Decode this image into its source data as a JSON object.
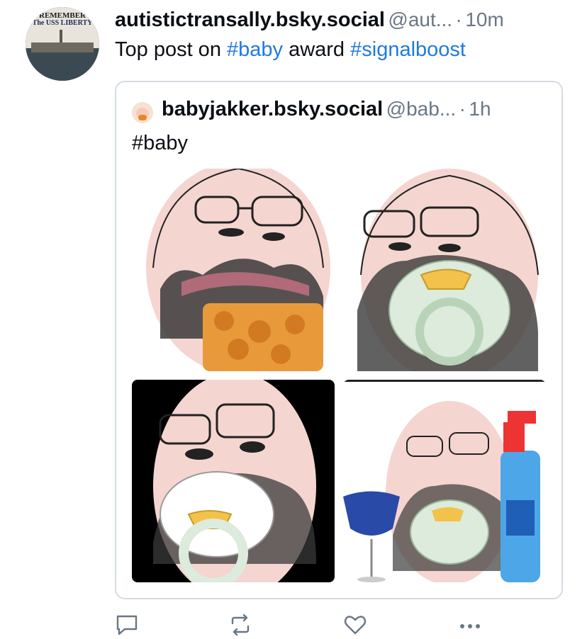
{
  "post": {
    "display_name": "autistictransally.bsky.social",
    "handle": "@aut...",
    "separator": "·",
    "time": "10m",
    "text_plain_1": "Top post on ",
    "tag_1": "#baby",
    "text_plain_2": " award ",
    "tag_2": "#signalboost",
    "avatar_text_line1": "REMEMBER",
    "avatar_text_line2": "The USS LIBERTY"
  },
  "quote": {
    "display_name": "babyjakker.bsky.social",
    "handle": "@bab...",
    "separator": "·",
    "time": "1h",
    "text": "#baby",
    "images": [
      {
        "subject": "bearded face with glasses eating nuggets"
      },
      {
        "subject": "bearded face with glasses and pacifier"
      },
      {
        "subject": "bearded face with glasses and pacifier on black background"
      },
      {
        "subject": "bearded face with pacifier, wine glass and spray bottle"
      }
    ]
  },
  "actions": [
    {
      "icon": "reply-icon"
    },
    {
      "icon": "repost-icon"
    },
    {
      "icon": "like-icon"
    },
    {
      "icon": "more-icon"
    }
  ],
  "colors": {
    "link": "#1f7ae0",
    "muted": "#6a7784",
    "border": "#d4dbe2",
    "skin": "#f5d5d0",
    "pacifier": "#dcebdc",
    "nugget": "#e89a3a"
  }
}
